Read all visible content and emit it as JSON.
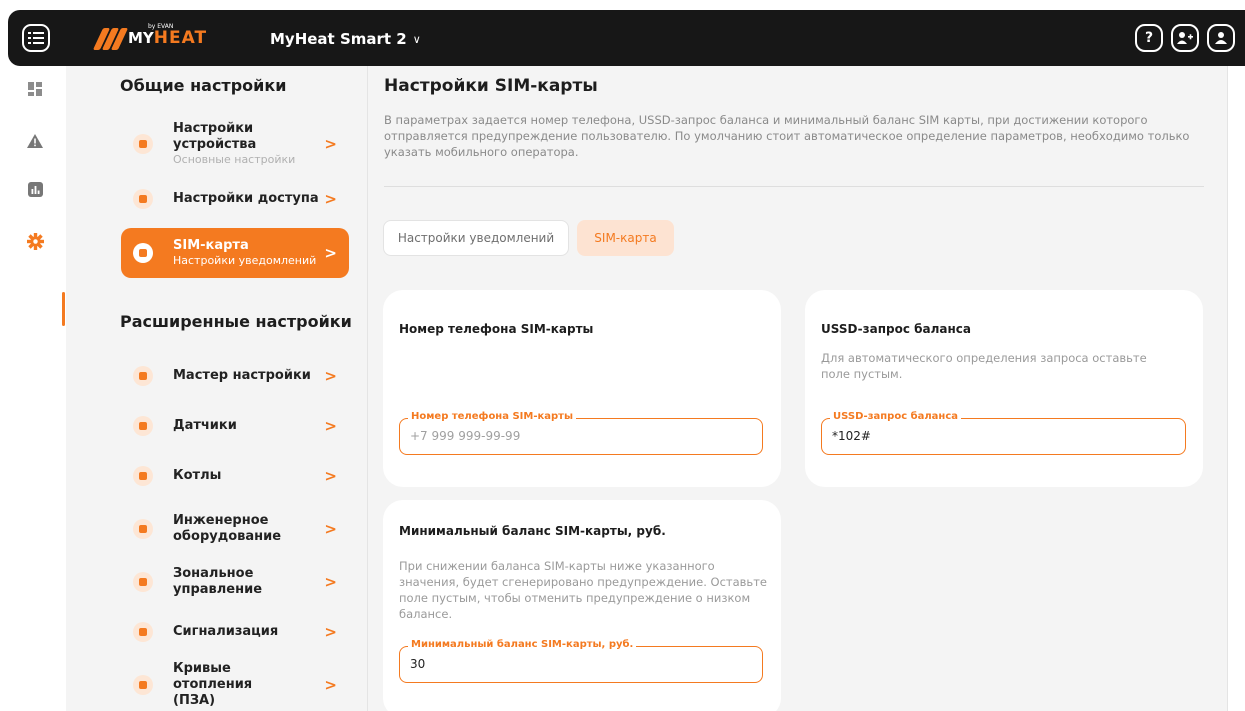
{
  "topbar": {
    "logo": {
      "my": "MY",
      "heat": "HEAT",
      "by": "by EVAN"
    },
    "device_name": "MyHeat Smart 2",
    "device_chevron": "∨",
    "help_label": "?",
    "icons": [
      "menu-icon",
      "help-icon",
      "add-user-icon",
      "profile-icon"
    ]
  },
  "rail": {
    "icons": [
      "dashboard-icon",
      "warning-icon",
      "stats-icon",
      "settings-icon"
    ],
    "active": "settings-icon"
  },
  "sidebar": {
    "general_title": "Общие настройки",
    "general_items": [
      {
        "title": "Настройки устройства",
        "subtitle": "Основные настройки",
        "icon": "device-settings-icon"
      },
      {
        "title": "Настройки доступа",
        "subtitle": "",
        "icon": "access-icon"
      },
      {
        "title": "SIM-карта",
        "subtitle": "Настройки уведомлений",
        "icon": "sim-icon",
        "active": true
      }
    ],
    "advanced_title": "Расширенные настройки",
    "advanced_items": [
      {
        "title": "Мастер настройки",
        "icon": "wizard-icon"
      },
      {
        "title": "Датчики",
        "icon": "sensor-icon"
      },
      {
        "title": "Котлы",
        "icon": "boiler-icon"
      },
      {
        "title": "Инженерное оборудование",
        "icon": "equipment-icon"
      },
      {
        "title": "Зональное управление",
        "icon": "zone-icon"
      },
      {
        "title": "Сигнализация",
        "icon": "alarm-icon"
      },
      {
        "title": "Кривые отопления (ПЗА)",
        "icon": "curve-icon"
      }
    ],
    "arrow": ">"
  },
  "main": {
    "title": "Настройки SIM-карты",
    "description": "В параметрах задается номер телефона, USSD-запрос баланса и минимальный баланс SIM карты, при достижении которого отправляется предупреждение пользователю. По умолчанию стоит автоматическое определение параметров, необходимо только указать мобильного оператора.",
    "tabs": [
      {
        "label": "Настройки уведомлений",
        "active": false
      },
      {
        "label": "SIM-карта",
        "active": true
      }
    ],
    "cards": {
      "phone": {
        "title": "Номер телефона SIM-карты",
        "field_label": "Номер телефона SIM-карты",
        "placeholder": "+7 999 999-99-99",
        "value": ""
      },
      "ussd": {
        "title": "USSD-запрос баланса",
        "description": "Для автоматического определения запроса оставьте поле пустым.",
        "field_label": "USSD-запрос баланса",
        "value": "*102#"
      },
      "min_balance": {
        "title": "Минимальный баланс SIM-карты, руб.",
        "description": "При снижении баланса SIM-карты ниже указанного значения, будет сгенерировано предупреждение. Оставьте поле пустым, чтобы отменить предупреждение о низком балансе.",
        "field_label": "Минимальный баланс SIM-карты, руб.",
        "value": "30"
      }
    }
  },
  "colors": {
    "accent": "#f47a20",
    "topbar": "#171717",
    "panel": "#f4f4f4"
  }
}
